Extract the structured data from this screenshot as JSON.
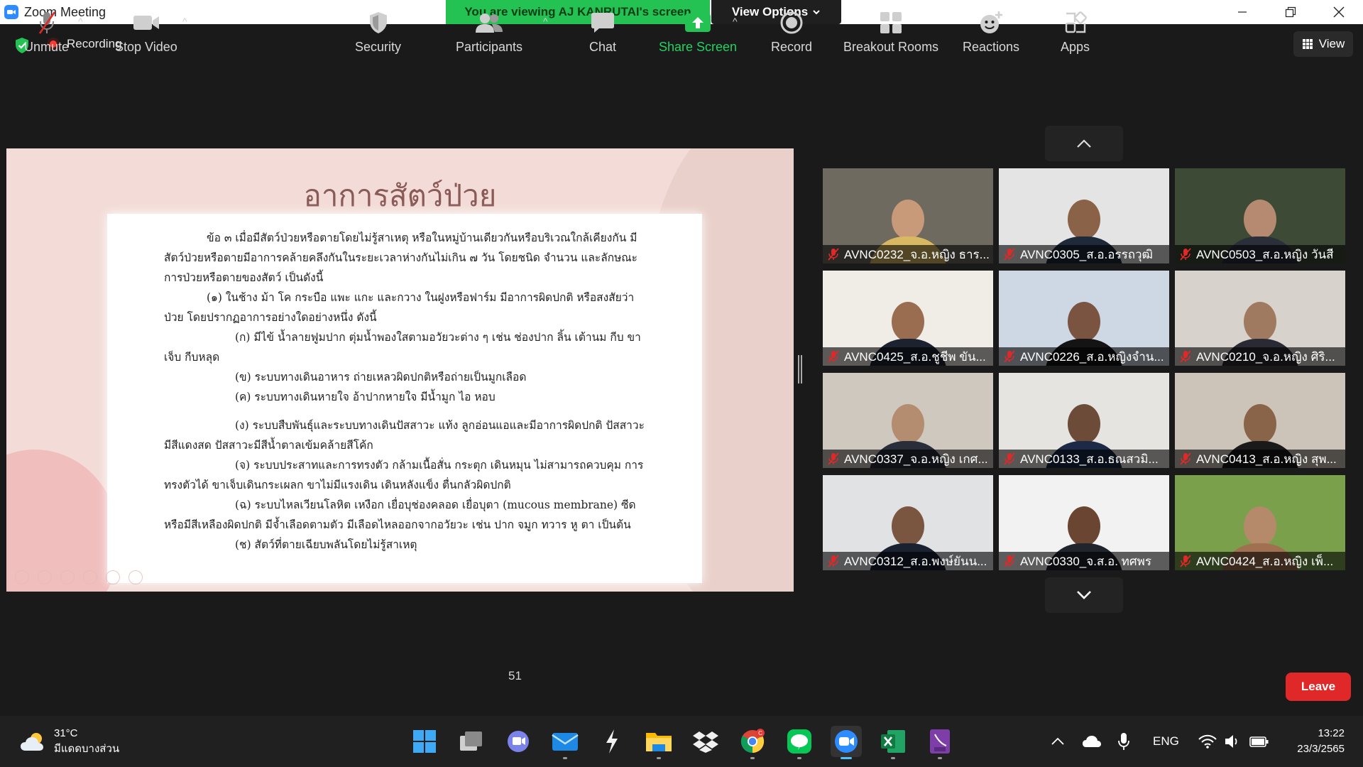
{
  "window": {
    "title": "Zoom Meeting",
    "viewing_banner": "You are viewing AJ KANRUTAI's screen",
    "view_options": "View Options"
  },
  "meeting": {
    "recording": "Recording",
    "view_label": "View"
  },
  "slide": {
    "title": "อาการสัตว์ป่วย",
    "paragraphs": [
      "ข้อ   ๓   เมื่อมีสัตว์ป่วยหรือตายโดยไม่รู้สาเหตุ  หรือในหมู่บ้านเดียวกันหรือบริเวณใกล้เคียงกัน มีสัตว์ป่วยหรือตายมีอาการคล้ายคลึงกันในระยะเวลาห่างกันไม่เกิน  ๗  วัน  โดยชนิด  จำนวน  และลักษณะ การป่วยหรือตายของสัตว์  เป็นดังนี้",
      "(๑)  ในช้าง  ม้า  โค  กระบือ  แพะ  แกะ  และกวาง  ในฝูงหรือฟาร์ม  มีอาการผิดปกติ หรือสงสัยว่าป่วย  โดยปรากฏอาการอย่างใดอย่างหนึ่ง  ดังนี้",
      "(ก)  มีไข้  น้ำลายฟูมปาก  ตุ่มน้ำพองใสตามอวัยวะต่าง ๆ  เช่น  ช่องปาก  ลิ้น  เต้านม กีบ  ขาเจ็บ  กีบหลุด",
      "(ข)   ระบบทางเดินอาหาร  ถ่ายเหลวผิดปกติหรือถ่ายเป็นมูกเลือด",
      "(ค)   ระบบทางเดินหายใจ  อ้าปากหายใจ  มีน้ำมูก  ไอ  หอบ",
      "(ง)   ระบบสืบพันธุ์และระบบทางเดินปัสสาวะ  แท้ง  ลูกอ่อนแอและมีอาการผิดปกติ ปัสสาวะมีสีแดงสด  ปัสสาวะมีสีน้ำตาลเข้มคล้ายสีโค้ก",
      "(จ)   ระบบประสาทและการทรงตัว  กล้ามเนื้อสั่น  กระตุก  เดินหมุน  ไม่สามารถควบคุม การทรงตัวได้  ขาเจ็บเดินกระเผลก  ขาไม่มีแรงเดิน  เดินหลังแข็ง  ตื่นกลัวผิดปกติ",
      "(ฉ)   ระบบไหลเวียนโลหิต  เหงือก  เยื่อบุช่องคลอด  เยื่อบุตา  (mucous  membrane) ซีดหรือมีสีเหลืองผิดปกติ  มีจ้ำเลือดตามตัว  มีเลือดไหลออกจากอวัยวะ  เช่น  ปาก  จมูก  ทวาร  หู  ตา เป็นต้น",
      "(ช)   สัตว์ที่ตายเฉียบพลันโดยไม่รู้สาเหตุ"
    ]
  },
  "participants": [
    {
      "name": "AVNC0232_จ.อ.หญิง ธาร...",
      "bg": "#6e6a60",
      "skin": "#c99a7a",
      "shirt": "#d8b860"
    },
    {
      "name": "AVNC0305_ส.อ.อรรถวุฒิ",
      "bg": "#e4e4e4",
      "skin": "#8a6248",
      "shirt": "#1e2a3a"
    },
    {
      "name": "AVNC0503_ส.อ.หญิง วันสี",
      "bg": "#3c4a36",
      "skin": "#b58a70",
      "shirt": "#2a2f3a"
    },
    {
      "name": "AVNC0425_ส.อ.ชูชีพ ขัน...",
      "bg": "#f0ede6",
      "skin": "#9a6c50",
      "shirt": "#1c2230"
    },
    {
      "name": "AVNC0226_ส.อ.หญิงจำน...",
      "bg": "#cdd8e4",
      "skin": "#7a5440",
      "shirt": "#141414"
    },
    {
      "name": "AVNC0210_จ.อ.หญิง ศิริ...",
      "bg": "#d8d2cc",
      "skin": "#a07a60",
      "shirt": "#2a2a34"
    },
    {
      "name": "AVNC0337_จ.อ.หญิง เกศ...",
      "bg": "#cfc8bf",
      "skin": "#b48c70",
      "shirt": "#2a2e3a"
    },
    {
      "name": "AVNC0133_ส.อ.ธณสวมิ...",
      "bg": "#e6e4e0",
      "skin": "#6c4c38",
      "shirt": "#1c2a48"
    },
    {
      "name": "AVNC0413_ส.อ.หญิง สุพ...",
      "bg": "#ccc4b8",
      "skin": "#8a6448",
      "shirt": "#1a1a1a"
    },
    {
      "name": "AVNC0312_ส.อ.พงษ์ยันน...",
      "bg": "#e0e2e4",
      "skin": "#7a5640",
      "shirt": "#1a2130"
    },
    {
      "name": "AVNC0330_จ.ส.อ. ทศพร",
      "bg": "#f2f2f2",
      "skin": "#6a4632",
      "shirt": "#20242c"
    },
    {
      "name": "AVNC0424_ส.อ.หญิง เพ็...",
      "bg": "#7aa04c",
      "skin": "#b48a6a",
      "shirt": "#a07050"
    }
  ],
  "toolbar": {
    "unmute": "Unmute",
    "stop_video": "Stop Video",
    "security": "Security",
    "participants": "Participants",
    "participants_count": "51",
    "chat": "Chat",
    "share_screen": "Share Screen",
    "record": "Record",
    "breakout_rooms": "Breakout Rooms",
    "reactions": "Reactions",
    "apps": "Apps",
    "leave": "Leave"
  },
  "taskbar": {
    "weather_temp": "31°C",
    "weather_desc": "มีแดดบางส่วน",
    "language": "ENG",
    "time": "13:22",
    "date": "23/3/2565",
    "chrome_badge": "C"
  }
}
